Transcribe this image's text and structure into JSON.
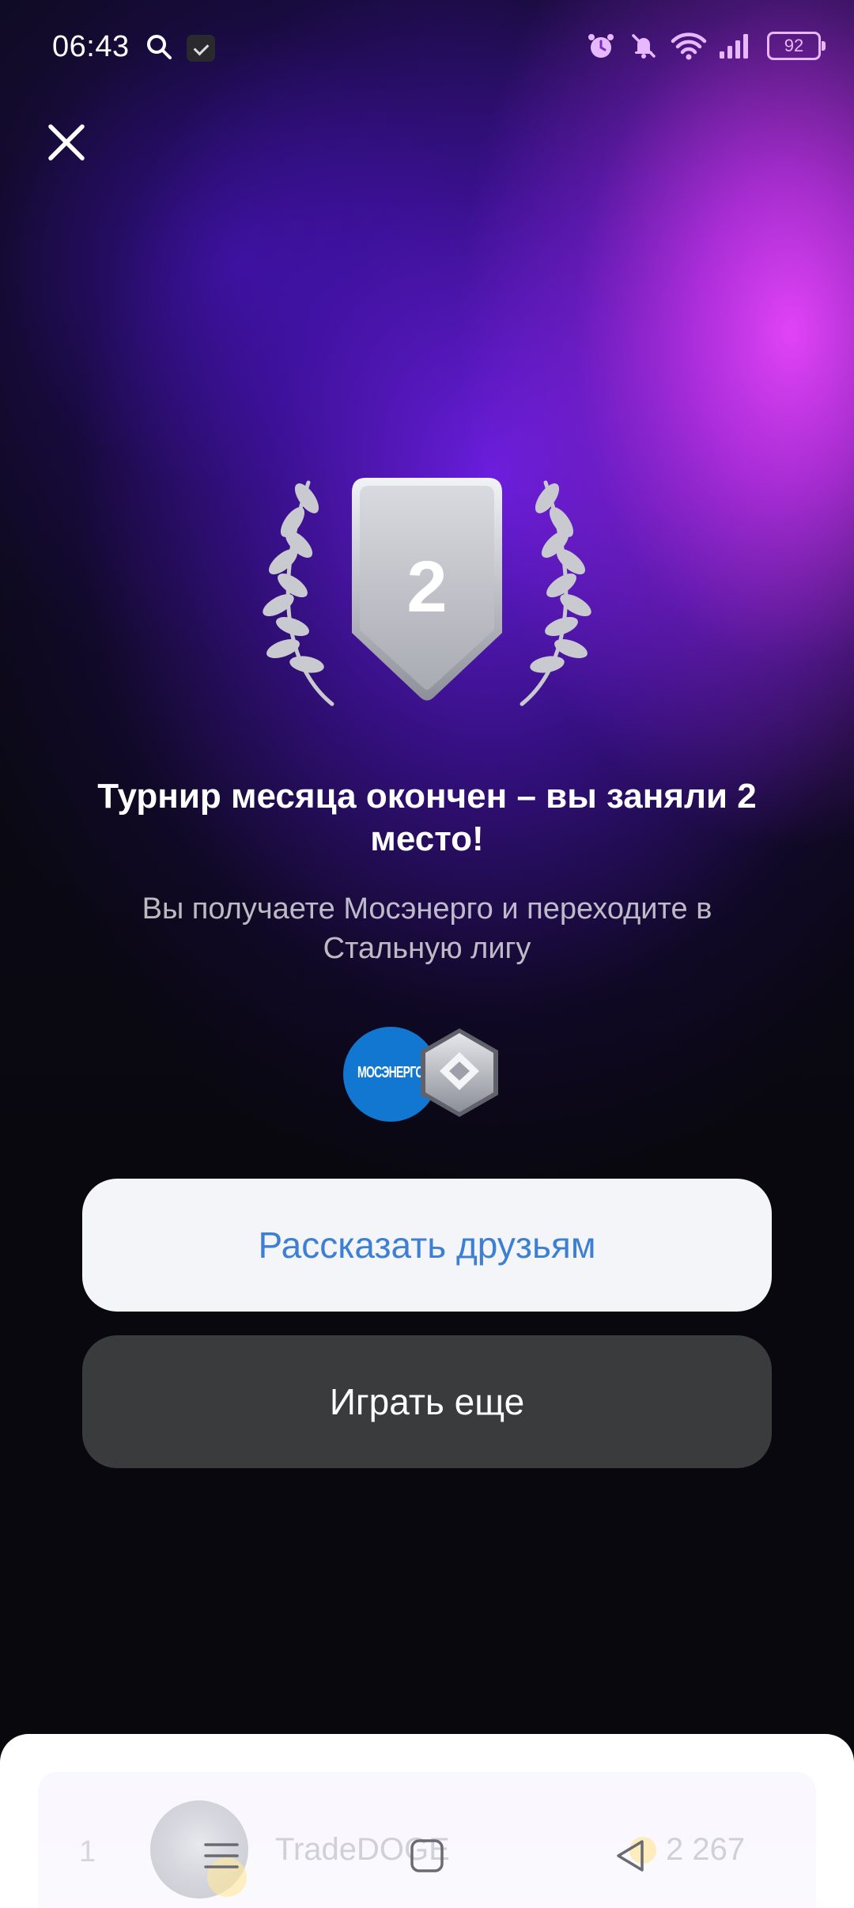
{
  "status_bar": {
    "time": "06:43",
    "battery": "92",
    "icons": [
      "search-icon",
      "app-notification-icon",
      "alarm-icon",
      "bell-muted-icon",
      "wifi-icon",
      "signal-icon",
      "battery-icon"
    ]
  },
  "close_icon": "close-icon",
  "medal": {
    "place": "2",
    "icons": [
      "laurel-left-icon",
      "shield-medal-icon",
      "laurel-right-icon"
    ],
    "color": "#c9cacf"
  },
  "title": "Турнир месяца окончен – вы заняли 2 место!",
  "subtitle": "Вы получаете Мосэнерго и переходите в Стальную лигу",
  "rewards": {
    "company_logo_text": "МОСЭНЕРГО",
    "company_color": "#1277d0",
    "league_icon": "steel-league-icon"
  },
  "buttons": {
    "share": "Рассказать друзьям",
    "play_again": "Играть еще"
  },
  "leaderboard_row": {
    "rank": "1",
    "name": "TradeDOGE",
    "score": "2 267",
    "icons": [
      "avatar",
      "coin-icon"
    ]
  },
  "nav_bar": {
    "icons": [
      "menu-icon",
      "home-icon",
      "back-icon"
    ]
  },
  "colors": {
    "accent_blue": "#3d7fd4",
    "dark_button": "#393b3d",
    "light_button": "#f3f5f8",
    "glow_purple": "#e046ff"
  }
}
